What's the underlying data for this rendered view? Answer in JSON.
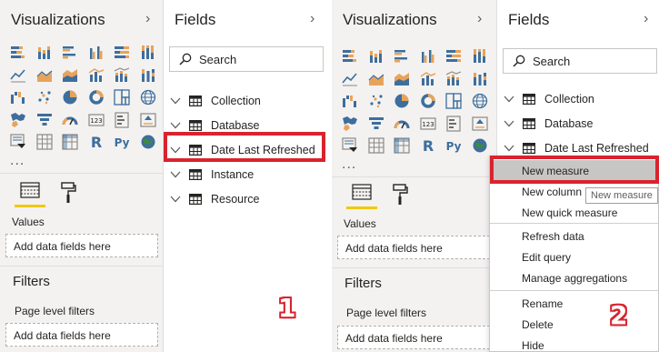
{
  "left": {
    "visualizations": {
      "title": "Visualizations",
      "more": "..."
    },
    "fields": {
      "title": "Fields",
      "search_placeholder": "Search"
    },
    "values_label": "Values",
    "values_drop": "Add data fields here",
    "filters_title": "Filters",
    "page_filters_label": "Page level filters",
    "page_filters_drop": "Add data fields here",
    "tables": [
      "Collection",
      "Database",
      "Date Last Refreshed",
      "Instance",
      "Resource"
    ],
    "step": "1"
  },
  "right": {
    "visualizations": {
      "title": "Visualizations",
      "more": "..."
    },
    "fields": {
      "title": "Fields",
      "search_placeholder": "Search"
    },
    "values_label": "Values",
    "values_drop": "Add data fields here",
    "filters_title": "Filters",
    "page_filters_label": "Page level filters",
    "page_filters_drop": "Add data fields here",
    "tables": [
      "Collection",
      "Database",
      "Date Last Refreshed"
    ],
    "context_menu": [
      "New measure",
      "New column",
      "New quick measure",
      "Refresh data",
      "Edit query",
      "Manage aggregations",
      "Rename",
      "Delete",
      "Hide"
    ],
    "tooltip": "New measure",
    "step": "2"
  },
  "icons": {
    "visuals": [
      "stacked-bar-chart-icon",
      "stacked-column-chart-icon",
      "clustered-bar-chart-icon",
      "clustered-column-chart-icon",
      "100-stacked-bar-chart-icon",
      "100-stacked-column-chart-icon",
      "line-chart-icon",
      "area-chart-icon",
      "stacked-area-chart-icon",
      "line-and-column-chart-icon",
      "line-and-stacked-column-chart-icon",
      "ribbon-chart-icon",
      "waterfall-chart-icon",
      "scatter-chart-icon",
      "pie-chart-icon",
      "donut-chart-icon",
      "treemap-icon",
      "map-icon",
      "filled-map-icon",
      "funnel-icon",
      "gauge-icon",
      "card-icon",
      "multi-row-card-icon",
      "kpi-icon",
      "slicer-icon",
      "table-visual-icon",
      "matrix-icon",
      "r-script-visual-icon",
      "python-visual-icon",
      "arcgis-map-icon"
    ]
  },
  "colors": {
    "accent_yellow": "#f2c811",
    "annotation_red": "#d9232e",
    "icon_blue": "#3e6e9c",
    "icon_orange": "#e8a35a"
  }
}
